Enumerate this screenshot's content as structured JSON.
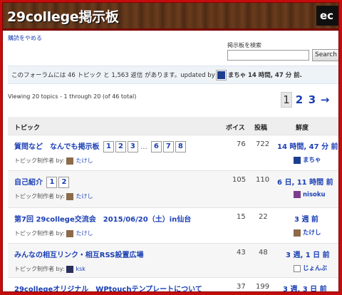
{
  "header": {
    "title": "29college掲示板",
    "logo_text": "ec"
  },
  "unsubscribe_link": "購読をやめる",
  "search": {
    "label": "掲示板を検索",
    "value": "",
    "button_label": "Search"
  },
  "forum_info": {
    "text": "このフォーラムには 46 トピック と 1,563 返信 があります。updated by",
    "user": "まちゃ",
    "time": "14 時間, 47 分 前."
  },
  "viewing_text": "Viewing 20 topics - 1 through 20 (of 46 total)",
  "pagination": {
    "current": "1",
    "pages": [
      "2",
      "3"
    ],
    "next": "→"
  },
  "table": {
    "headers": {
      "topic": "トピック",
      "voices": "ボイス",
      "posts": "投稿",
      "freshness": "鮮度"
    },
    "rows": [
      {
        "title": "質問など　なんでも掲示板",
        "pages": [
          "1",
          "2",
          "3",
          "6",
          "7",
          "8"
        ],
        "ellipsis": "…",
        "starter_label": "トピック制作者 by:",
        "starter": "たけし",
        "voices": "76",
        "posts": "722",
        "freshness": "14 時間, 47 分 前",
        "last_user": "まちゃ"
      },
      {
        "title": "自己紹介",
        "pages": [
          "1",
          "2"
        ],
        "starter_label": "トピック制作者 by:",
        "starter": "たけし",
        "voices": "105",
        "posts": "110",
        "freshness": "6 日, 11 時間 前",
        "last_user": "nisoku"
      },
      {
        "title": "第7回 29college交流会　2015/06/20（土）in仙台",
        "pages": [],
        "starter_label": "トピック制作者 by:",
        "starter": "たけし",
        "voices": "15",
        "posts": "22",
        "freshness": "3 週 前",
        "last_user": "たけし"
      },
      {
        "title": "みんなの相互リンク・相互RSS設置広場",
        "pages": [],
        "starter_label": "トピック制作者 by:",
        "starter": "ksk",
        "voices": "43",
        "posts": "48",
        "freshness": "3 週, 1 日 前",
        "last_user": "じょんぶ"
      },
      {
        "title": "29collegeオリジナル　WPtouchテンプレートについて",
        "pages": [],
        "voices": "37",
        "posts": "199",
        "freshness": "3 週, 3 日 前"
      }
    ]
  },
  "colors": {
    "frame": "#c40d0d",
    "link": "#1a3fb5",
    "header_wood": "#5a3218"
  }
}
